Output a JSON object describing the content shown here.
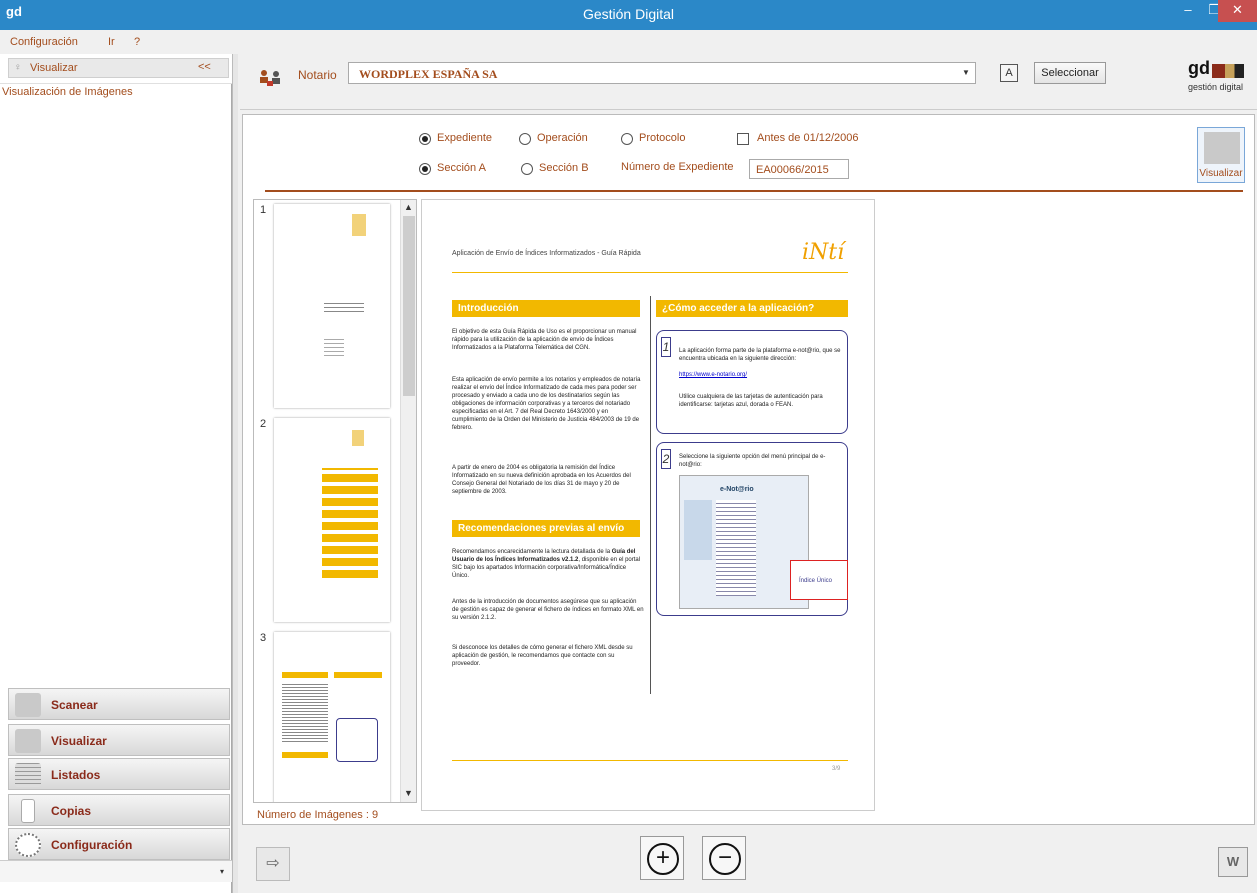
{
  "window": {
    "logo": "gd",
    "title": "Gestión Digital",
    "minimize": "–",
    "maximize": "❐",
    "close": "✕"
  },
  "menu": {
    "items": [
      "Configuración",
      "Ir",
      "?"
    ]
  },
  "left_panel": {
    "header_label": "Visualizar",
    "collapse": "<<",
    "subtitle": "Visualización de Imágenes",
    "nav": [
      {
        "label": "Scanear",
        "icon": "scan-eye-icon"
      },
      {
        "label": "Visualizar",
        "icon": "visualize-icon"
      },
      {
        "label": "Listados",
        "icon": "list-grid-icon"
      },
      {
        "label": "Copias",
        "icon": "copy-doc-icon"
      },
      {
        "label": "Configuración",
        "icon": "settings-dots-icon"
      }
    ],
    "footer_arrow": "▾"
  },
  "toolbar": {
    "notary_label": "Notario",
    "notary_value": "WORDPLEX ESPAÑA SA",
    "btn_a": "A",
    "select_label": "Seleccionar",
    "brand_logo": "gd",
    "brand_text": "gestión digital"
  },
  "filters": {
    "type_options": [
      "Expediente",
      "Operación",
      "Protocolo"
    ],
    "type_selected": "Expediente",
    "before_checkbox": "Antes de 01/12/2006",
    "section_options": [
      "Sección A",
      "Sección B"
    ],
    "section_selected": "Sección A",
    "expediente_label": "Número de Expediente",
    "expediente_value": "EA00066/2015",
    "visualize_btn": "Visualizar"
  },
  "thumbnails": {
    "pages": [
      "1",
      "2",
      "3"
    ],
    "count_label": "Número de Imágenes  : 9"
  },
  "document": {
    "header": "Aplicación de Envío de Índices Informatizados - Guía Rápida",
    "logo": "iNtí",
    "intro_title": "Introducción",
    "intro_p1": "El objetivo de esta Guía Rápida de Uso es el proporcionar un manual rápido para la utilización de la aplicación de envío de Índices Informatizados a la Plataforma Telemática del CGN.",
    "intro_p2": "Esta aplicación de envío permite a los notarios y empleados de notaría realizar el envío del Índice Informatizado de cada mes para poder ser procesado y enviado a cada uno de los destinatarios según las obligaciones de información corporativas y a terceros del notariado especificadas en el Art. 7 del Real Decreto 1643/2000 y en cumplimiento de la Orden del Ministerio de Justicia 484/2003 de 19 de febrero.",
    "intro_p3": "A partir de enero de 2004 es obligatoria la remisión del Índice Informatizado en su nueva definición aprobada en los Acuerdos del Consejo General del Notariado de los días 31 de mayo y 20 de septiembre de 2003.",
    "rec_title": "Recomendaciones previas al envío",
    "rec_p1a": "Recomendamos encarecidamente la lectura detallada de la ",
    "rec_p1b": "Guía del Usuario de los Índices Informatizados v2.1.2",
    "rec_p1c": ", disponible en el portal SIC bajo los apartados Información corporativa/Informática/Índice Único.",
    "rec_p2": "Antes de la introducción de documentos asegúrese que su aplicación de gestión es capaz de generar el fichero de índices en formato XML en su versión 2.1.2.",
    "rec_p3": "Si desconoce los detalles de cómo generar el fichero XML desde su aplicación de gestión, le recomendamos que contacte con su proveedor.",
    "access_title": "¿Cómo acceder a la aplicación?",
    "step1_num": "1",
    "step1_text": "La aplicación forma parte de la plataforma e-not@rio, que se encuentra ubicada en la siguiente dirección:",
    "step1_link": "https://www.e-notario.org/",
    "step1_text2": "Utilice cualquiera de las tarjetas de autenticación para identificarse: tarjetas azul, dorada o FEAN.",
    "step2_num": "2",
    "step2_text": "Seleccione la siguiente opción del menú principal de e-not@rio:",
    "shot_title": "e-Not@rio",
    "shot_callout": "Índice Único",
    "page_num": "3/9"
  },
  "bottom": {
    "arrow": "⇨",
    "zoom_in": "+",
    "zoom_out": "−",
    "word": "W"
  }
}
